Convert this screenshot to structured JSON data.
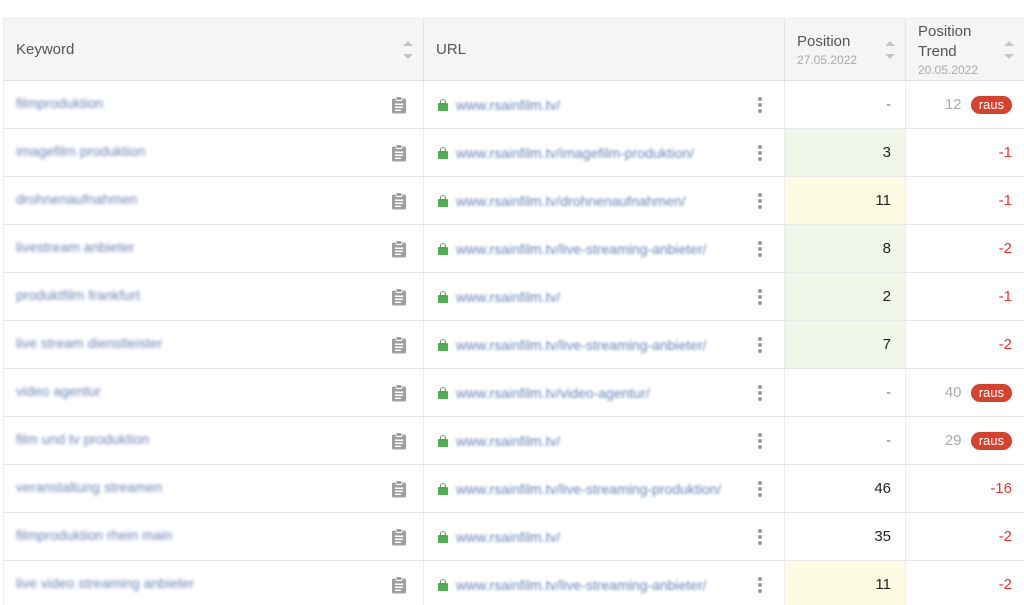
{
  "header": {
    "keyword": "Keyword",
    "url": "URL",
    "position": "Position",
    "position_date": "27.05.2022",
    "trend_line1": "Position",
    "trend_line2": "Trend",
    "trend_date": "20.05.2022"
  },
  "colors": {
    "green_cell": "#f0f6e8",
    "yellow_cell": "#fefbe3",
    "trend_red": "#e53935",
    "badge_red": "#d9412f",
    "lock_green": "#4caf50"
  },
  "rows": [
    {
      "keyword": "filmproduktion",
      "url": "www.rsainfilm.tv/",
      "position": "-",
      "trend": "",
      "prev": "12",
      "badge": "raus"
    },
    {
      "keyword": "imagefilm produktion",
      "url": "www.rsainfilm.tv/imagefilm-produktion/",
      "position": "3",
      "trend": "-1",
      "prev": "",
      "badge": ""
    },
    {
      "keyword": "drohnenaufnahmen",
      "url": "www.rsainfilm.tv/drohnenaufnahmen/",
      "position": "11",
      "trend": "-1",
      "prev": "",
      "badge": ""
    },
    {
      "keyword": "livestream anbieter",
      "url": "www.rsainfilm.tv/live-streaming-anbieter/",
      "position": "8",
      "trend": "-2",
      "prev": "",
      "badge": ""
    },
    {
      "keyword": "produktfilm frankfurt",
      "url": "www.rsainfilm.tv/",
      "position": "2",
      "trend": "-1",
      "prev": "",
      "badge": ""
    },
    {
      "keyword": "live stream dienstleister",
      "url": "www.rsainfilm.tv/live-streaming-anbieter/",
      "position": "7",
      "trend": "-2",
      "prev": "",
      "badge": ""
    },
    {
      "keyword": "video agentur",
      "url": "www.rsainfilm.tv/video-agentur/",
      "position": "-",
      "trend": "",
      "prev": "40",
      "badge": "raus"
    },
    {
      "keyword": "film und tv produktion",
      "url": "www.rsainfilm.tv/",
      "position": "-",
      "trend": "",
      "prev": "29",
      "badge": "raus"
    },
    {
      "keyword": "veranstaltung streamen",
      "url": "www.rsainfilm.tv/live-streaming-produktion/",
      "position": "46",
      "trend": "-16",
      "prev": "",
      "badge": ""
    },
    {
      "keyword": "filmproduktion rhein main",
      "url": "www.rsainfilm.tv/",
      "position": "35",
      "trend": "-2",
      "prev": "",
      "badge": ""
    },
    {
      "keyword": "live video streaming anbieter",
      "url": "www.rsainfilm.tv/live-streaming-anbieter/",
      "position": "11",
      "trend": "-2",
      "prev": "",
      "badge": ""
    }
  ]
}
